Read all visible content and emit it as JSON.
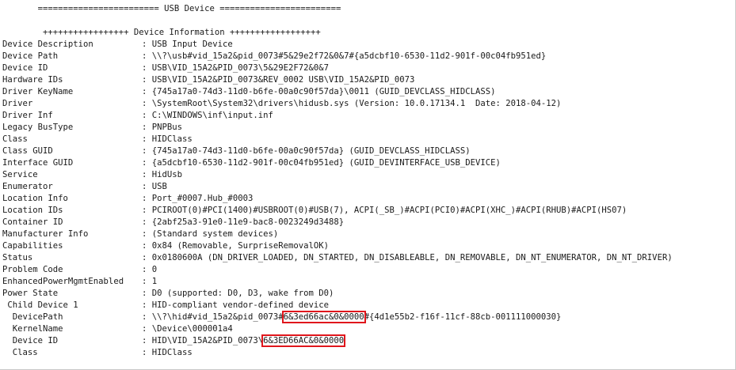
{
  "banner": "       ======================== USB Device ========================",
  "section_header": "        +++++++++++++++++ Device Information ++++++++++++++++++",
  "rows": [
    {
      "key": "Device Description",
      "value": "USB Input Device"
    },
    {
      "key": "Device Path",
      "value": "\\\\?\\usb#vid_15a2&pid_0073#5&29e2f72&0&7#{a5dcbf10-6530-11d2-901f-00c04fb951ed}"
    },
    {
      "key": "Device ID",
      "value": "USB\\VID_15A2&PID_0073\\5&29E2F72&0&7"
    },
    {
      "key": "Hardware IDs",
      "value": "USB\\VID_15A2&PID_0073&REV_0002 USB\\VID_15A2&PID_0073"
    },
    {
      "key": "Driver KeyName",
      "value": "{745a17a0-74d3-11d0-b6fe-00a0c90f57da}\\0011 (GUID_DEVCLASS_HIDCLASS)"
    },
    {
      "key": "Driver",
      "value": "\\SystemRoot\\System32\\drivers\\hidusb.sys (Version: 10.0.17134.1  Date: 2018-04-12)"
    },
    {
      "key": "Driver Inf",
      "value": "C:\\WINDOWS\\inf\\input.inf"
    },
    {
      "key": "Legacy BusType",
      "value": "PNPBus"
    },
    {
      "key": "Class",
      "value": "HIDClass"
    },
    {
      "key": "Class GUID",
      "value": "{745a17a0-74d3-11d0-b6fe-00a0c90f57da} (GUID_DEVCLASS_HIDCLASS)"
    },
    {
      "key": "Interface GUID",
      "value": "{a5dcbf10-6530-11d2-901f-00c04fb951ed} (GUID_DEVINTERFACE_USB_DEVICE)"
    },
    {
      "key": "Service",
      "value": "HidUsb"
    },
    {
      "key": "Enumerator",
      "value": "USB"
    },
    {
      "key": "Location Info",
      "value": "Port_#0007.Hub_#0003"
    },
    {
      "key": "Location IDs",
      "value": "PCIROOT(0)#PCI(1400)#USBROOT(0)#USB(7), ACPI(_SB_)#ACPI(PCI0)#ACPI(XHC_)#ACPI(RHUB)#ACPI(HS07)"
    },
    {
      "key": "Container ID",
      "value": "{2abf25a3-91e0-11e9-bac8-0023249d3488}"
    },
    {
      "key": "Manufacturer Info",
      "value": "(Standard system devices)"
    },
    {
      "key": "Capabilities",
      "value": "0x84 (Removable, SurpriseRemovalOK)"
    },
    {
      "key": "Status",
      "value": "0x0180600A (DN_DRIVER_LOADED, DN_STARTED, DN_DISABLEABLE, DN_REMOVABLE, DN_NT_ENUMERATOR, DN_NT_DRIVER)"
    },
    {
      "key": "Problem Code",
      "value": "0"
    },
    {
      "key": "EnhancedPowerMgmtEnabled",
      "value": "1"
    },
    {
      "key": "Power State",
      "value": "D0 (supported: D0, D3, wake from D0)"
    }
  ],
  "child": {
    "header_key": " Child Device 1",
    "header_value": "HID-compliant vendor-defined device",
    "device_path_key": "  DevicePath",
    "device_path_pre": "\\\\?\\hid#vid_15a2&pid_0073#",
    "device_path_hl": "6&3ed66ac&0&0000",
    "device_path_post": "#{4d1e55b2-f16f-11cf-88cb-001111000030}",
    "kernel_name_key": "  KernelName",
    "kernel_name_value": "\\Device\\000001a4",
    "device_id_key": "  Device ID",
    "device_id_pre": "HID\\VID_15A2&PID_0073\\",
    "device_id_hl": "6&3ED66AC&0&0000",
    "class_key": "  Class",
    "class_value": "HIDClass"
  },
  "separator": ": ",
  "highlight_color": "#e0161c"
}
